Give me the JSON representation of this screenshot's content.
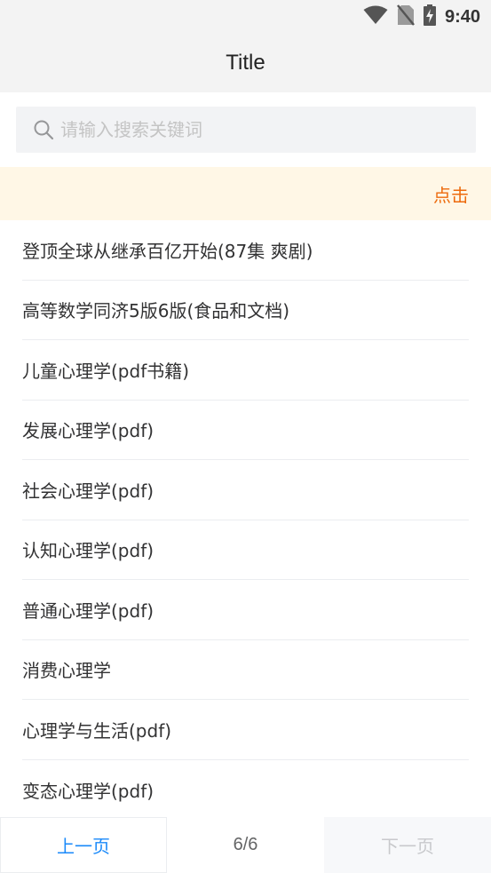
{
  "status_bar": {
    "time": "9:40",
    "icons": [
      "wifi-icon",
      "no-sim-icon",
      "battery-charging-icon"
    ]
  },
  "app_bar": {
    "title": "Title"
  },
  "search": {
    "placeholder": "请输入搜索关键词",
    "value": "",
    "icon": "search-icon"
  },
  "notice": {
    "action_label": "点击",
    "color": "#ed6a0c",
    "background": "#fff7e6"
  },
  "list": {
    "items": [
      "登顶全球从继承百亿开始(87集 爽剧)",
      "高等数学同济5版6版(食品和文档)",
      "儿童心理学(pdf书籍)",
      "发展心理学(pdf)",
      "社会心理学(pdf)",
      "认知心理学(pdf)",
      "普通心理学(pdf)",
      "消费心理学",
      "心理学与生活(pdf)",
      "变态心理学(pdf)"
    ]
  },
  "pagination": {
    "prev_label": "上一页",
    "page_desc": "6/6",
    "next_label": "下一页",
    "accent_color": "#1989fa",
    "disabled_color": "#c8c9cc"
  }
}
